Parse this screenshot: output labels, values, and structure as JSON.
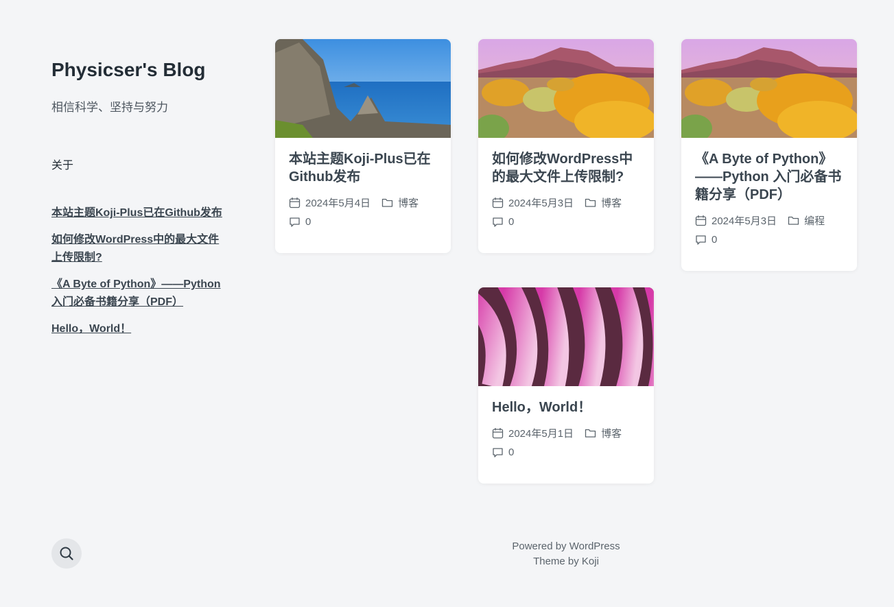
{
  "site": {
    "title": "Physicser's Blog",
    "description": "相信科学、坚持与努力"
  },
  "sidebar": {
    "about_label": "关于",
    "recent_posts": [
      "本站主题Koji-Plus已在Github发布",
      "如何修改WordPress中的最大文件上传限制?",
      "《A Byte of Python》——Python 入门必备书籍分享（PDF）",
      "Hello，World！"
    ]
  },
  "posts": [
    {
      "title": "本站主题Koji-Plus已在Github发布",
      "date": "2024年5月4日",
      "category": "博客",
      "comments": "0",
      "thumb": "coastal-ruins"
    },
    {
      "title": "如何修改WordPress中的最大文件上传限制?",
      "date": "2024年5月3日",
      "category": "博客",
      "comments": "0",
      "thumb": "desert-flowers"
    },
    {
      "title": "《A Byte of Python》——Python 入门必备书籍分享（PDF）",
      "date": "2024年5月3日",
      "category": "编程",
      "comments": "0",
      "thumb": "desert-flowers"
    },
    {
      "title": "Hello，World！",
      "date": "2024年5月1日",
      "category": "博客",
      "comments": "0",
      "thumb": "flower-leis"
    }
  ],
  "footer": {
    "powered": "Powered by WordPress",
    "theme": "Theme by Koji"
  },
  "icons": {
    "search": "search-icon",
    "date": "calendar-icon",
    "category": "folder-icon",
    "comments": "comment-icon"
  }
}
